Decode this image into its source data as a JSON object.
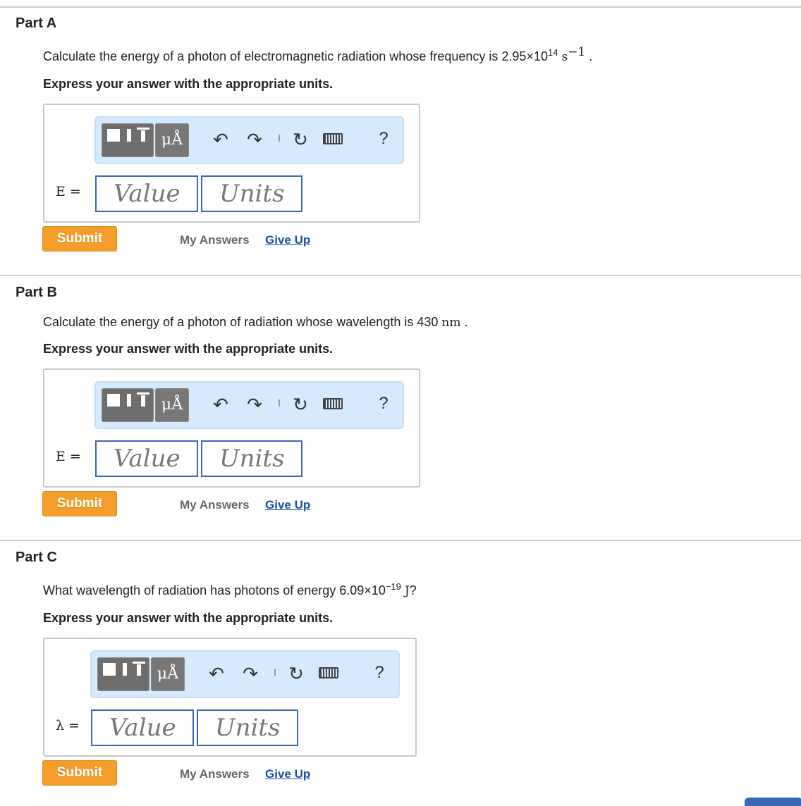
{
  "parts": [
    {
      "title": "Part A",
      "question_prefix": "Calculate the energy of a photon of electromagnetic radiation whose frequency is 2.95×10",
      "question_sup": "14",
      "question_unit": "s",
      "question_unit_sup": "−1",
      "question_suffix": ".",
      "instruction": "Express your answer with the appropriate units.",
      "variable": "E =",
      "value_placeholder": "Value",
      "units_placeholder": "Units",
      "submit": "Submit",
      "my_answers": "My Answers",
      "give_up": "Give Up"
    },
    {
      "title": "Part B",
      "question_prefix": "Calculate the energy of a photon of radiation whose wavelength is 430",
      "question_unit": "nm",
      "question_suffix": ".",
      "instruction": "Express your answer with the appropriate units.",
      "variable": "E =",
      "value_placeholder": "Value",
      "units_placeholder": "Units",
      "submit": "Submit",
      "my_answers": "My Answers",
      "give_up": "Give Up"
    },
    {
      "title": "Part C",
      "question_prefix": "What wavelength of radiation has photons of energy 6.09×10",
      "question_sup": "−19",
      "question_unit": "J",
      "question_suffix": "?",
      "instruction": "Express your answer with the appropriate units.",
      "variable": "λ =",
      "value_placeholder": "Value",
      "units_placeholder": "Units",
      "submit": "Submit",
      "my_answers": "My Answers",
      "give_up": "Give Up"
    }
  ],
  "toolbar": {
    "units_button": "μÅ",
    "help": "?"
  }
}
